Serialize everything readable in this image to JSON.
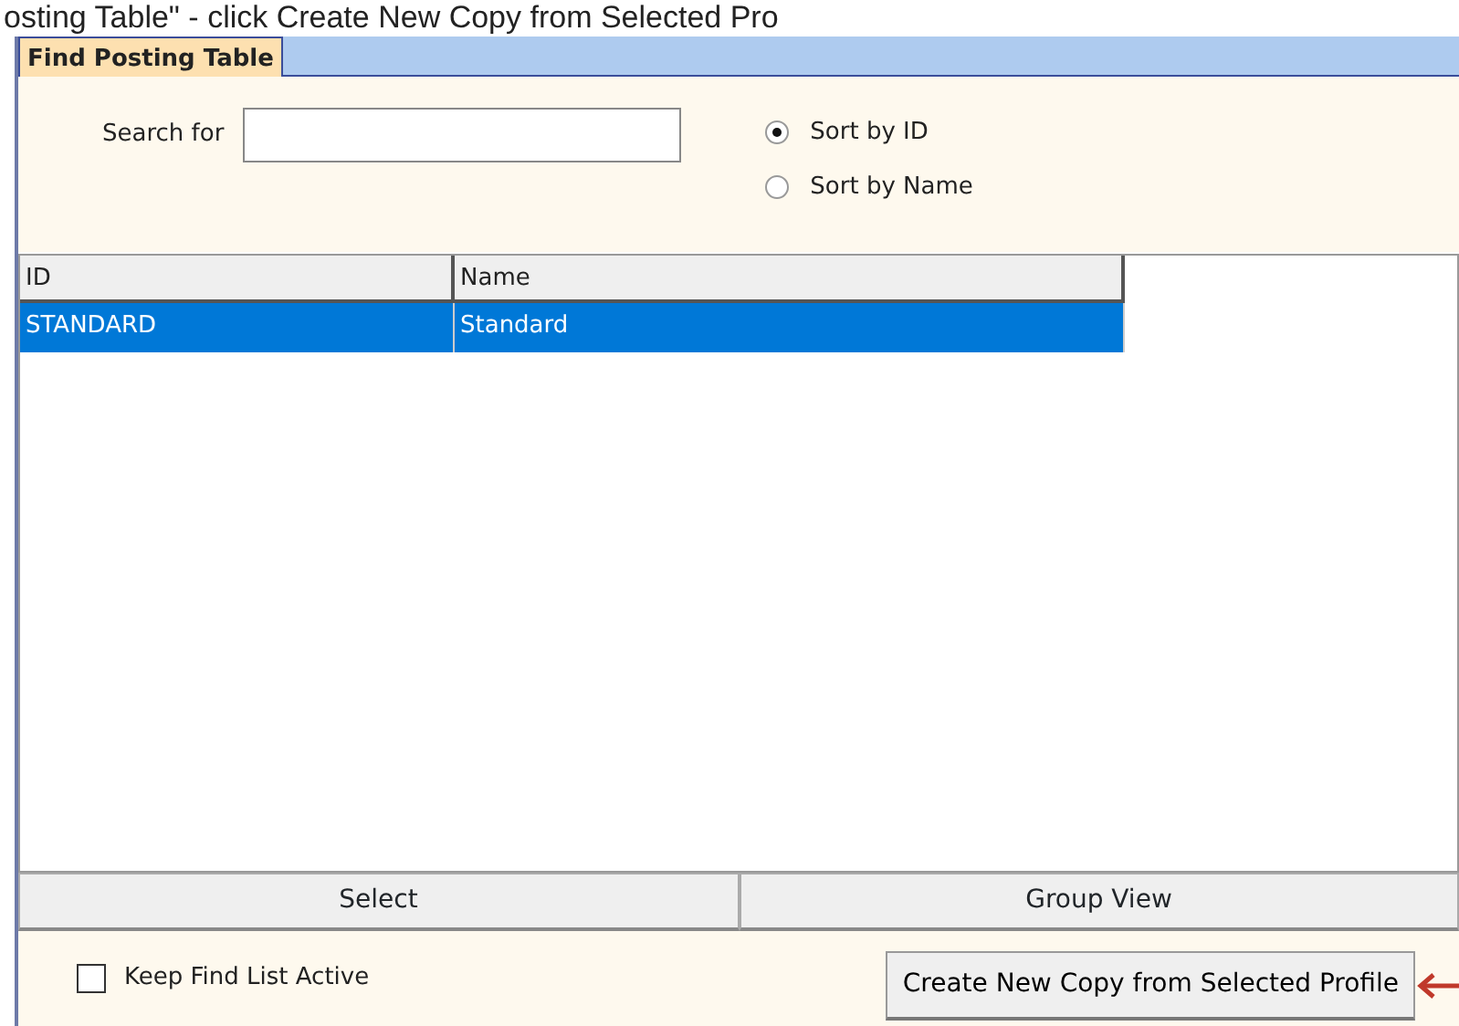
{
  "caption": "osting Table\" - click Create New Copy from Selected Pro",
  "tabs": [
    {
      "label": "Find Posting Table",
      "selected": true
    }
  ],
  "search": {
    "label": "Search for"
  },
  "sort_options": [
    {
      "label": "Sort by ID",
      "selected": true
    },
    {
      "label": "Sort by Name",
      "selected": false
    }
  ],
  "table": {
    "columns": [
      "ID",
      "Name"
    ],
    "rows": [
      {
        "cells": [
          "STANDARD",
          "Standard"
        ],
        "selected": true
      }
    ]
  },
  "action_buttons": [
    "Select",
    "Group View"
  ],
  "keep_active": {
    "label": "Keep Find List Active",
    "checked": false
  },
  "create_button": "Create New Copy from Selected Profile"
}
